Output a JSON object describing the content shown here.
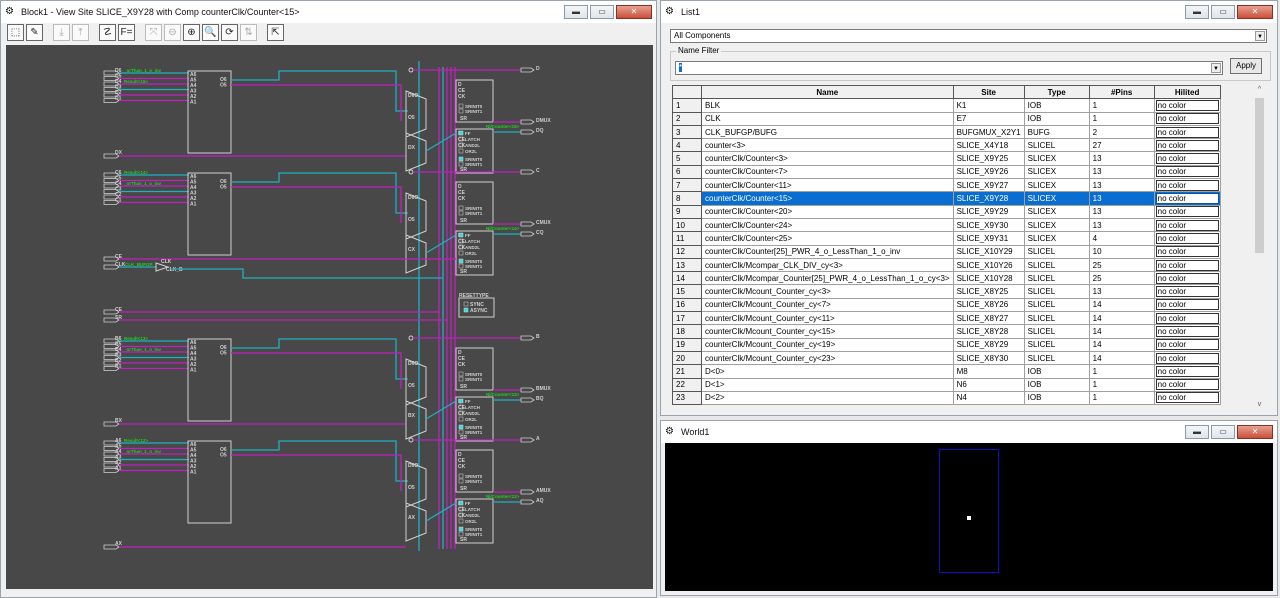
{
  "block_window": {
    "title": "Block1 - View Site SLICE_X9Y28 with Comp counterClk/Counter<15>",
    "toolbar": [
      {
        "icon": "select-icon",
        "glyph": "⬚",
        "enabled": true
      },
      {
        "icon": "edit-pencil-icon",
        "glyph": "✎",
        "enabled": true
      },
      {
        "icon": "download-icon",
        "glyph": "⤓",
        "enabled": false
      },
      {
        "icon": "upload-icon",
        "glyph": "⤒",
        "enabled": false
      },
      {
        "icon": "route-icon",
        "glyph": "☡",
        "enabled": true
      },
      {
        "icon": "formula-icon",
        "glyph": "F=",
        "enabled": true
      },
      {
        "icon": "fit-icon",
        "glyph": "⤧",
        "enabled": false
      },
      {
        "icon": "zoom-out-icon",
        "glyph": "⊖",
        "enabled": false
      },
      {
        "icon": "zoom-in-icon",
        "glyph": "⊕",
        "enabled": true
      },
      {
        "icon": "zoom-area-icon",
        "glyph": "🔍",
        "enabled": true
      },
      {
        "icon": "refresh-icon",
        "glyph": "⟳",
        "enabled": true
      },
      {
        "icon": "route-pins-icon",
        "glyph": "⇅",
        "enabled": false
      },
      {
        "icon": "export-icon",
        "glyph": "⇱",
        "enabled": true
      }
    ],
    "schematic": {
      "quadrants": [
        {
          "inputs": [
            "D6",
            "D5",
            "D4",
            "D3",
            "D2",
            "D1"
          ],
          "x_input": "DX",
          "out": "D",
          "mux_out": "DMUX",
          "q_out": "DQ",
          "net_labels": [
            "_orThan_1_o_inv",
            "Result<15>"
          ],
          "ff_net": "Nl/Counter<15>"
        },
        {
          "inputs": [
            "C6",
            "C5",
            "C4",
            "C3",
            "C2",
            "C1"
          ],
          "x_input": "",
          "out": "C",
          "mux_out": "CMUX",
          "q_out": "CQ",
          "net_labels": [
            "Result<14>",
            "_orThan_1_o_inv"
          ],
          "ff_net": "Nl/Counter<14>"
        },
        {
          "inputs": [
            "B6",
            "B5",
            "B4",
            "B3",
            "B2",
            "B1"
          ],
          "x_input": "BX",
          "out": "B",
          "mux_out": "BMUX",
          "q_out": "BQ",
          "net_labels": [
            "Result<13>",
            "_orThan_1_o_inv"
          ],
          "ff_net": "Nl/Counter<13>"
        },
        {
          "inputs": [
            "A6",
            "A5",
            "A4",
            "A3",
            "A2",
            "A1"
          ],
          "x_input": "AX",
          "out": "A",
          "mux_out": "AMUX",
          "q_out": "AQ",
          "net_labels": [
            "Result<12>",
            "_orThan_1_o_inv"
          ],
          "ff_net": "Nl/Counter<12>"
        }
      ],
      "lut_pins": [
        "A6",
        "A5",
        "A4",
        "A3",
        "A2",
        "A1"
      ],
      "lut_outs": [
        "O6",
        "O5"
      ],
      "ff_pins": [
        "D",
        "CE",
        "CK"
      ],
      "ff_opts": [
        "FF",
        "LATCH",
        "AND2L",
        "OR2L"
      ],
      "srinit": [
        "SRINIT0",
        "SRINIT1"
      ],
      "sr_label": "SR",
      "ctrl": {
        "ce": "CE",
        "clk": "CLK",
        "clk_net": "CLK_BUFGP",
        "sr": "SR",
        "bufg_in": "CLK",
        "bufg_out": "CLK_B",
        "ce2": "CE"
      },
      "resettype": {
        "title": "RESETTYPE",
        "options": [
          "SYNC",
          "ASYNC"
        ],
        "selected": "ASYNC"
      },
      "colors": {
        "background": "#484848",
        "net_magenta": "#c020c0",
        "net_cyan": "#20b0c0",
        "label_green": "#20d020",
        "outline": "#d0d0d0"
      }
    }
  },
  "list_window": {
    "title": "List1",
    "filter_select": "All Components",
    "name_filter_label": "Name Filter",
    "name_filter_value": "*",
    "apply": "Apply",
    "columns": [
      "",
      "Name",
      "Site",
      "Type",
      "#Pins",
      "Hilited"
    ],
    "selected_row": 8,
    "rows": [
      [
        "1",
        "BLK",
        "K1",
        "IOB",
        "1",
        "no color"
      ],
      [
        "2",
        "CLK",
        "E7",
        "IOB",
        "1",
        "no color"
      ],
      [
        "3",
        "CLK_BUFGP/BUFG",
        "BUFGMUX_X2Y1",
        "BUFG",
        "2",
        "no color"
      ],
      [
        "4",
        "counter<3>",
        "SLICE_X4Y18",
        "SLICEL",
        "27",
        "no color"
      ],
      [
        "5",
        "counterClk/Counter<3>",
        "SLICE_X9Y25",
        "SLICEX",
        "13",
        "no color"
      ],
      [
        "6",
        "counterClk/Counter<7>",
        "SLICE_X9Y26",
        "SLICEX",
        "13",
        "no color"
      ],
      [
        "7",
        "counterClk/Counter<11>",
        "SLICE_X9Y27",
        "SLICEX",
        "13",
        "no color"
      ],
      [
        "8",
        "counterClk/Counter<15>",
        "SLICE_X9Y28",
        "SLICEX",
        "13",
        "no color"
      ],
      [
        "9",
        "counterClk/Counter<20>",
        "SLICE_X9Y29",
        "SLICEX",
        "13",
        "no color"
      ],
      [
        "10",
        "counterClk/Counter<24>",
        "SLICE_X9Y30",
        "SLICEX",
        "13",
        "no color"
      ],
      [
        "11",
        "counterClk/Counter<25>",
        "SLICE_X9Y31",
        "SLICEX",
        "4",
        "no color"
      ],
      [
        "12",
        "counterClk/Counter[25]_PWR_4_o_LessThan_1_o_inv",
        "SLICE_X10Y29",
        "SLICEL",
        "10",
        "no color"
      ],
      [
        "13",
        "counterClk/Mcompar_CLK_DIV_cy<3>",
        "SLICE_X10Y26",
        "SLICEL",
        "25",
        "no color"
      ],
      [
        "14",
        "counterClk/Mcompar_Counter[25]_PWR_4_o_LessThan_1_o_cy<3>",
        "SLICE_X10Y28",
        "SLICEL",
        "25",
        "no color"
      ],
      [
        "15",
        "counterClk/Mcount_Counter_cy<3>",
        "SLICE_X8Y25",
        "SLICEL",
        "13",
        "no color"
      ],
      [
        "16",
        "counterClk/Mcount_Counter_cy<7>",
        "SLICE_X8Y26",
        "SLICEL",
        "14",
        "no color"
      ],
      [
        "17",
        "counterClk/Mcount_Counter_cy<11>",
        "SLICE_X8Y27",
        "SLICEL",
        "14",
        "no color"
      ],
      [
        "18",
        "counterClk/Mcount_Counter_cy<15>",
        "SLICE_X8Y28",
        "SLICEL",
        "14",
        "no color"
      ],
      [
        "19",
        "counterClk/Mcount_Counter_cy<19>",
        "SLICE_X8Y29",
        "SLICEL",
        "14",
        "no color"
      ],
      [
        "20",
        "counterClk/Mcount_Counter_cy<23>",
        "SLICE_X8Y30",
        "SLICEL",
        "14",
        "no color"
      ],
      [
        "21",
        "D<0>",
        "M8",
        "IOB",
        "1",
        "no color"
      ],
      [
        "22",
        "D<1>",
        "N6",
        "IOB",
        "1",
        "no color"
      ],
      [
        "23",
        "D<2>",
        "N4",
        "IOB",
        "1",
        "no color"
      ]
    ],
    "selection_color": "#0a6ed1"
  },
  "world_window": {
    "title": "World1",
    "colors": {
      "background": "#000000",
      "frame": "#1010c0",
      "marker": "#ffffff"
    }
  }
}
